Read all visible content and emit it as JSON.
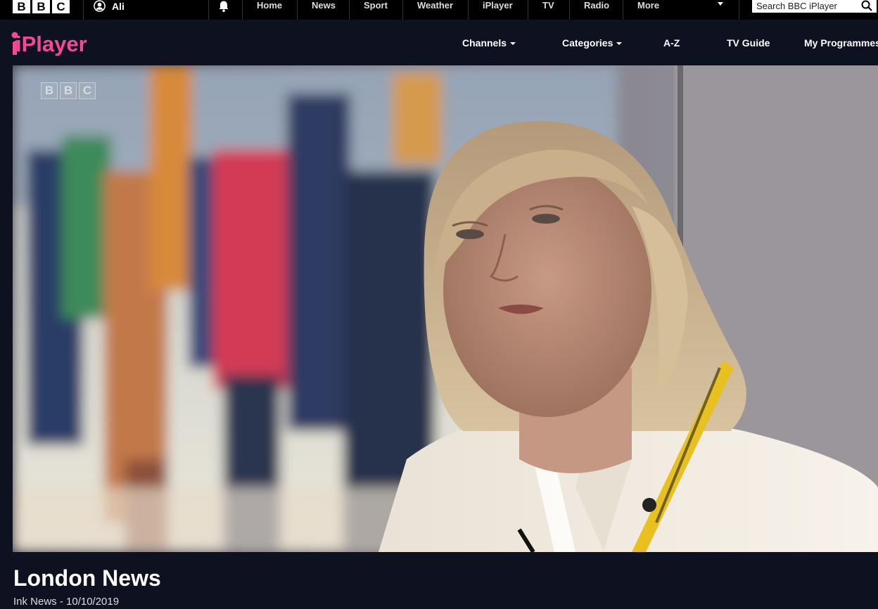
{
  "masthead": {
    "logo_letters": [
      "B",
      "B",
      "C"
    ],
    "account_name": "Ali",
    "nav_items": [
      "Home",
      "News",
      "Sport",
      "Weather",
      "iPlayer",
      "TV",
      "Radio",
      "More"
    ],
    "search_placeholder": "Search BBC iPlayer"
  },
  "iplayer": {
    "logo_text": "iPlayer",
    "logo_color": "#f54997",
    "nav": {
      "channels": "Channels",
      "categories": "Categories",
      "az": "A-Z",
      "tv_guide": "TV Guide",
      "my_programmes": "My Programmes"
    }
  },
  "player": {
    "watermark_letters": [
      "B",
      "B",
      "C"
    ]
  },
  "programme": {
    "title": "London News",
    "subtitle": "Ink News - 10/10/2019"
  }
}
